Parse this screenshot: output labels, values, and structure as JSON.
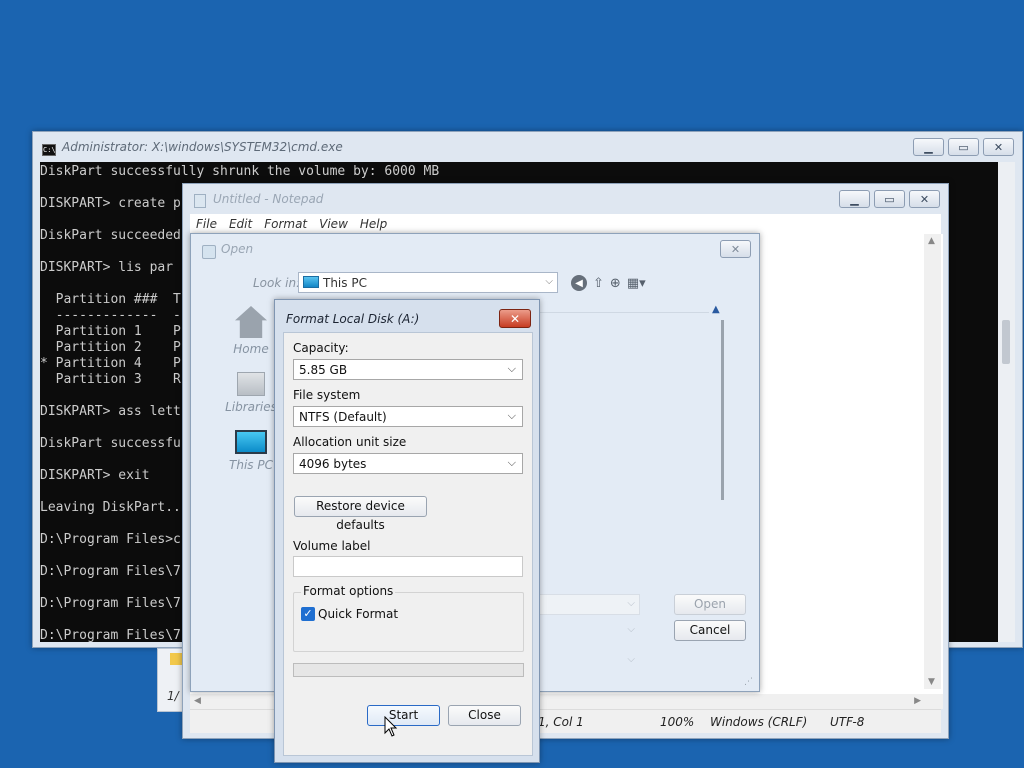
{
  "cmd": {
    "title": "Administrator: X:\\windows\\SYSTEM32\\cmd.exe",
    "icon_text": "C:\\",
    "lines": "DiskPart successfully shrunk the volume by: 6000 MB\n\nDISKPART> create p\n\nDiskPart succeeded\n\nDISKPART> lis par\n\n  Partition ###  T\n  -------------  -\n  Partition 1    P\n  Partition 2    P\n* Partition 4    P\n  Partition 3    R\n\nDISKPART> ass lett\n\nDiskPart successfu\n\nDISKPART> exit\n\nLeaving DiskPart..\n\nD:\\Program Files>c\n\nD:\\Program Files\\7\n\nD:\\Program Files\\7\n\nD:\\Program Files\\7"
  },
  "notepad": {
    "title": "Untitled - Notepad",
    "menu": [
      "File",
      "Edit",
      "Format",
      "View",
      "Help"
    ],
    "status": {
      "position": "1, Col 1",
      "zoom": "100%",
      "line_ending": "Windows (CRLF)",
      "encoding": "UTF-8"
    },
    "behind_label": "1/"
  },
  "open_dialog": {
    "title": "Open",
    "look_in_label": "Look in:",
    "look_in_value": "This PC",
    "places": [
      {
        "label": "Home",
        "icon": "home-icon"
      },
      {
        "label": "Libraries",
        "icon": "libraries-icon"
      },
      {
        "label": "This PC",
        "icon": "this-pc-icon"
      }
    ],
    "open_button": "Open",
    "cancel_button": "Cancel"
  },
  "format_dialog": {
    "title": "Format Local Disk (A:)",
    "capacity_label": "Capacity:",
    "capacity_value": "5.85 GB",
    "filesystem_label": "File system",
    "filesystem_value": "NTFS (Default)",
    "allocation_label": "Allocation unit size",
    "allocation_value": "4096 bytes",
    "restore_button": "Restore device defaults",
    "volume_label": "Volume label",
    "volume_value": "",
    "options_group": "Format options",
    "quick_format_label": "Quick Format",
    "quick_format_checked": true,
    "progress": 0,
    "start_button": "Start",
    "close_button": "Close"
  },
  "colors": {
    "desktop": "#1b64b0",
    "console_bg": "#0c0c0c",
    "console_text": "#cccccc",
    "checkbox": "#1f6fd1",
    "close_button": "#c73c22"
  }
}
